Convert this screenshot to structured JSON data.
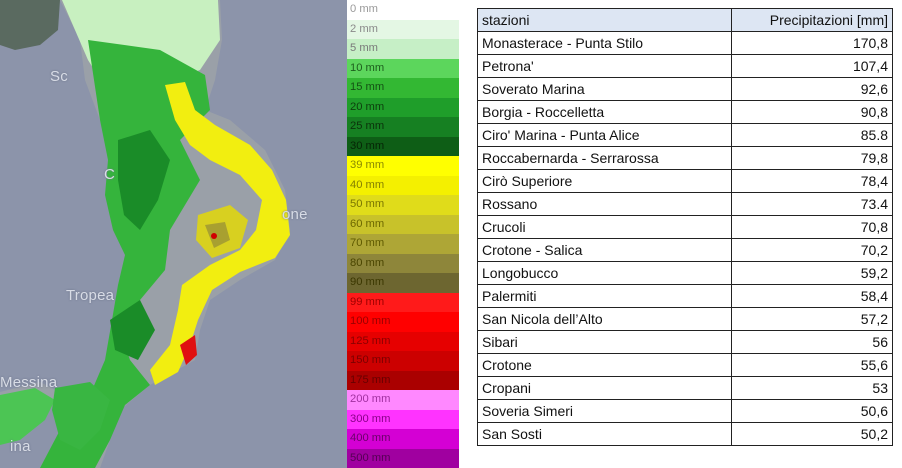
{
  "map": {
    "place_labels": [
      {
        "id": "scalea",
        "text": "Sc"
      },
      {
        "id": "cosenza",
        "text": "C"
      },
      {
        "id": "crotone",
        "text": "one"
      },
      {
        "id": "tropea",
        "text": "Tropea"
      },
      {
        "id": "messina",
        "text": "Messina"
      },
      {
        "id": "catania",
        "text": "ina"
      }
    ]
  },
  "legend": [
    {
      "label": "0 mm",
      "color": "#ffffff",
      "text_color": "#9a9a9a"
    },
    {
      "label": "2 mm",
      "color": "#e4f7e4",
      "text_color": "#8a8a8a"
    },
    {
      "label": "5 mm",
      "color": "#c6efc6",
      "text_color": "#7a7a7a"
    },
    {
      "label": "10 mm",
      "color": "#5cd65c",
      "text_color": "#1d5e1d"
    },
    {
      "label": "15 mm",
      "color": "#33b833",
      "text_color": "#145214"
    },
    {
      "label": "20 mm",
      "color": "#1f9e2a",
      "text_color": "#0d3f0d"
    },
    {
      "label": "25 mm",
      "color": "#168022",
      "text_color": "#0b320b"
    },
    {
      "label": "30 mm",
      "color": "#0e5e16",
      "text_color": "#062506"
    },
    {
      "label": "39 mm",
      "color": "#ffff00",
      "text_color": "#8a8a00"
    },
    {
      "label": "40 mm",
      "color": "#f4f000",
      "text_color": "#858000"
    },
    {
      "label": "50 mm",
      "color": "#e0dc1a",
      "text_color": "#7a7600"
    },
    {
      "label": "60 mm",
      "color": "#c8c22a",
      "text_color": "#6d6800"
    },
    {
      "label": "70 mm",
      "color": "#aea636",
      "text_color": "#5f5a00"
    },
    {
      "label": "80 mm",
      "color": "#8e863a",
      "text_color": "#4a4500"
    },
    {
      "label": "90 mm",
      "color": "#6d6630",
      "text_color": "#3b3700"
    },
    {
      "label": "99 mm",
      "color": "#ff1a1a",
      "text_color": "#9e0000"
    },
    {
      "label": "100 mm",
      "color": "#ff0000",
      "text_color": "#990000"
    },
    {
      "label": "125 mm",
      "color": "#e60000",
      "text_color": "#8a0000"
    },
    {
      "label": "150 mm",
      "color": "#cc0000",
      "text_color": "#7a0000"
    },
    {
      "label": "175 mm",
      "color": "#aa0000",
      "text_color": "#660000"
    },
    {
      "label": "200 mm",
      "color": "#ff88ff",
      "text_color": "#a030a0"
    },
    {
      "label": "300 mm",
      "color": "#ff33ff",
      "text_color": "#8a008a"
    },
    {
      "label": "400 mm",
      "color": "#d400d4",
      "text_color": "#6a006a"
    },
    {
      "label": "500 mm",
      "color": "#a000a0",
      "text_color": "#540054"
    }
  ],
  "table": {
    "headers": {
      "station": "stazioni",
      "precip": "Precipitazioni [mm]"
    },
    "header_bg": "#dde6f3",
    "rows": [
      {
        "station": "Monasterace - Punta Stilo",
        "value": "170,8"
      },
      {
        "station": "Petrona'",
        "value": "107,4"
      },
      {
        "station": "Soverato Marina",
        "value": "92,6"
      },
      {
        "station": "Borgia - Roccelletta",
        "value": "90,8"
      },
      {
        "station": "Ciro' Marina - Punta Alice",
        "value": "85.8"
      },
      {
        "station": "Roccabernarda - Serrarossa",
        "value": "79,8"
      },
      {
        "station": "Cirò Superiore",
        "value": "78,4"
      },
      {
        "station": "Rossano",
        "value": "73.4"
      },
      {
        "station": "Crucoli",
        "value": "70,8"
      },
      {
        "station": "Crotone - Salica",
        "value": "70,2"
      },
      {
        "station": "Longobucco",
        "value": "59,2"
      },
      {
        "station": "Palermiti",
        "value": "58,4"
      },
      {
        "station": "San Nicola dell’Alto",
        "value": "57,2"
      },
      {
        "station": "Sibari",
        "value": "56"
      },
      {
        "station": "Crotone",
        "value": "55,6"
      },
      {
        "station": "Cropani",
        "value": "53"
      },
      {
        "station": "Soveria Simeri",
        "value": "50,6"
      },
      {
        "station": "San Sosti",
        "value": "50,2"
      }
    ]
  }
}
